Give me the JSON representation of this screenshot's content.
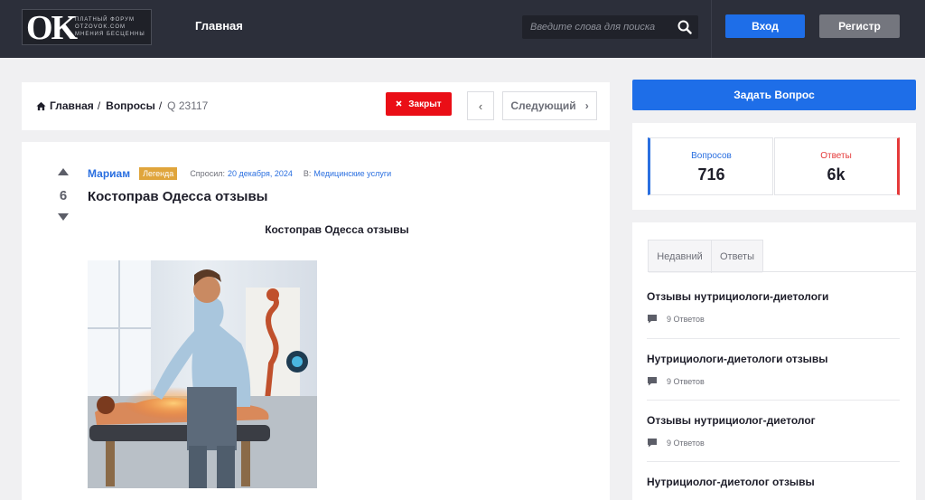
{
  "header": {
    "logo_text": "OK",
    "logo_tagline": "платный форум otzovok.com мнения бесценны",
    "nav_home": "Главная",
    "search_placeholder": "Введите слова для поиска",
    "login_label": "Вход",
    "register_label": "Регистр"
  },
  "breadcrumb": {
    "home": "Главная",
    "sep1": "/",
    "questions": "Вопросы",
    "sep2": "/",
    "current": "Q 23117"
  },
  "status_label": "Закрыт",
  "pager": {
    "prev_symbol": "‹",
    "next_label": "Следующий",
    "next_symbol": "›"
  },
  "question": {
    "votes": "6",
    "author": "Мариам",
    "badge": "Легенда",
    "asked_label": "Спросил:",
    "asked_date": "20 декабря, 2024",
    "category_label": "В:",
    "category": "Медицинские услуги",
    "title": "Костоправ Одесса отзывы",
    "subtitle": "Костоправ Одесса отзывы"
  },
  "sidebar": {
    "ask_button": "Задать Вопрос",
    "stats": {
      "questions_label": "Вопросов",
      "questions_value": "716",
      "answers_label": "Ответы",
      "answers_value": "6k"
    },
    "tabs": [
      "Недавний",
      "Ответы"
    ],
    "items": [
      {
        "title": "Отзывы нутрициологи-диетологи",
        "count": "9 Ответов"
      },
      {
        "title": "Нутрициологи-диетологи отзывы",
        "count": "9 Ответов"
      },
      {
        "title": "Отзывы нутрициолог-диетолог",
        "count": "9 Ответов"
      },
      {
        "title": "Нутрициолог-диетолог отзывы",
        "count": ""
      }
    ]
  },
  "colors": {
    "header_bg": "#2c2f3a",
    "primary": "#1e6ee8",
    "closed_red": "#ea0e16",
    "badge_gold": "#e0a53c",
    "link_blue": "#2a6fe0"
  }
}
